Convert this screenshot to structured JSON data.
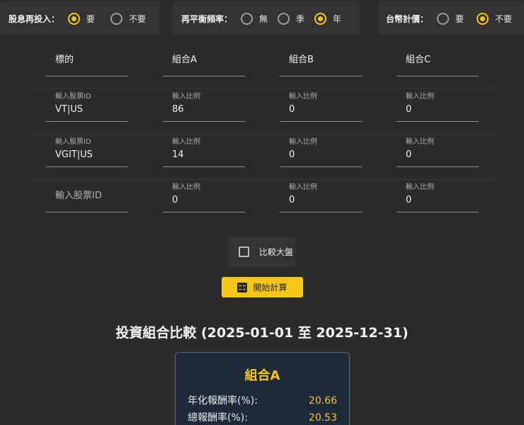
{
  "options": {
    "dividend": {
      "label": "股息再投入：",
      "choices": [
        "要",
        "不要"
      ],
      "selected": 0
    },
    "rebalance": {
      "label": "再平衡頻率：",
      "choices": [
        "無",
        "季",
        "年"
      ],
      "selected": 2
    },
    "twd": {
      "label": "台幣計價：",
      "choices": [
        "要",
        "不要"
      ],
      "selected": 1
    }
  },
  "table": {
    "headers": [
      "標的",
      "組合A",
      "組合B",
      "組合C"
    ],
    "ticker_label": "輸入股票ID",
    "ratio_label": "輸入比例",
    "rows": [
      {
        "ticker": "VT|US",
        "ratios": [
          "86",
          "0",
          "0"
        ]
      },
      {
        "ticker": "VGIT|US",
        "ratios": [
          "14",
          "0",
          "0"
        ]
      },
      {
        "ticker": "",
        "ratios": [
          "0",
          "0",
          "0"
        ]
      }
    ]
  },
  "compare": {
    "label": "比較大盤",
    "checked": false
  },
  "start_button": {
    "label": "開始計算",
    "icon": "calculator-icon"
  },
  "result": {
    "title": "投資組合比較 (2025-01-01 至 2025-12-31)",
    "card": {
      "name": "組合A",
      "metrics": [
        {
          "label": "年化報酬率(%):",
          "value": "20.66"
        },
        {
          "label": "總報酬率(%):",
          "value": "20.53"
        }
      ]
    }
  },
  "colors": {
    "accent": "#f5c518",
    "background": "#2b2b2b",
    "panel": "#333333",
    "card": "#1e2a3a"
  }
}
